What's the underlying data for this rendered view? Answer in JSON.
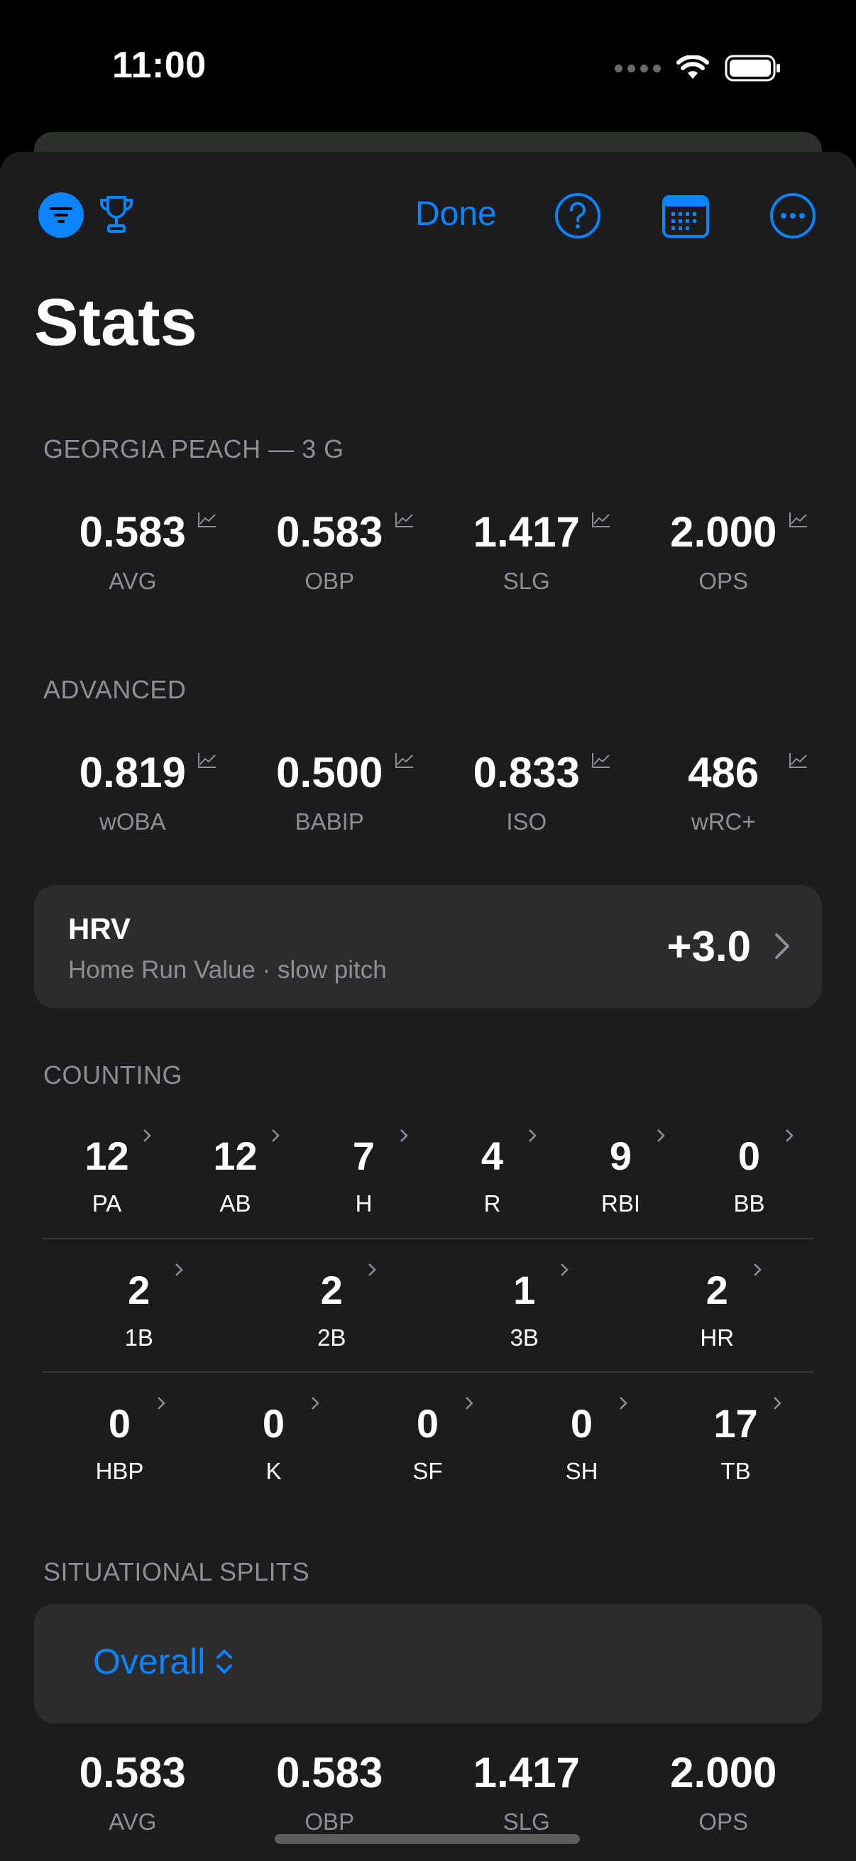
{
  "status": {
    "time": "11:00"
  },
  "toolbar": {
    "done_label": "Done"
  },
  "page": {
    "title": "Stats"
  },
  "team_section": {
    "label": "GEORGIA PEACH — 3 G",
    "stats": [
      {
        "value": "0.583",
        "caption": "AVG"
      },
      {
        "value": "0.583",
        "caption": "OBP"
      },
      {
        "value": "1.417",
        "caption": "SLG"
      },
      {
        "value": "2.000",
        "caption": "OPS"
      }
    ]
  },
  "advanced_section": {
    "label": "ADVANCED",
    "stats": [
      {
        "value": "0.819",
        "caption": "wOBA"
      },
      {
        "value": "0.500",
        "caption": "BABIP"
      },
      {
        "value": "0.833",
        "caption": "ISO"
      },
      {
        "value": "486",
        "caption": "wRC+"
      }
    ]
  },
  "hrv": {
    "title": "HRV",
    "subtitle": "Home Run Value · slow pitch",
    "value": "+3.0"
  },
  "counting_section": {
    "label": "COUNTING",
    "row1": [
      {
        "value": "12",
        "caption": "PA"
      },
      {
        "value": "12",
        "caption": "AB"
      },
      {
        "value": "7",
        "caption": "H"
      },
      {
        "value": "4",
        "caption": "R"
      },
      {
        "value": "9",
        "caption": "RBI"
      },
      {
        "value": "0",
        "caption": "BB"
      }
    ],
    "row2": [
      {
        "value": "2",
        "caption": "1B"
      },
      {
        "value": "2",
        "caption": "2B"
      },
      {
        "value": "1",
        "caption": "3B"
      },
      {
        "value": "2",
        "caption": "HR"
      }
    ],
    "row3": [
      {
        "value": "0",
        "caption": "HBP"
      },
      {
        "value": "0",
        "caption": "K"
      },
      {
        "value": "0",
        "caption": "SF"
      },
      {
        "value": "0",
        "caption": "SH"
      },
      {
        "value": "17",
        "caption": "TB"
      }
    ]
  },
  "splits_section": {
    "label": "SITUATIONAL SPLITS",
    "selected": "Overall",
    "stats": [
      {
        "value": "0.583",
        "caption": "AVG"
      },
      {
        "value": "0.583",
        "caption": "OBP"
      },
      {
        "value": "1.417",
        "caption": "SLG"
      },
      {
        "value": "2.000",
        "caption": "OPS"
      }
    ]
  },
  "colors": {
    "accent": "#0a84ff",
    "sheet": "#1c1c1e",
    "card": "#2c2c2e",
    "secondary_text": "#8e8e93"
  },
  "icons": [
    "filter-icon",
    "trophy-icon",
    "help-icon",
    "calendar-icon",
    "more-icon",
    "trend-icon",
    "chevron-right-icon",
    "chevron-up-down-icon",
    "wifi-icon",
    "battery-icon"
  ]
}
